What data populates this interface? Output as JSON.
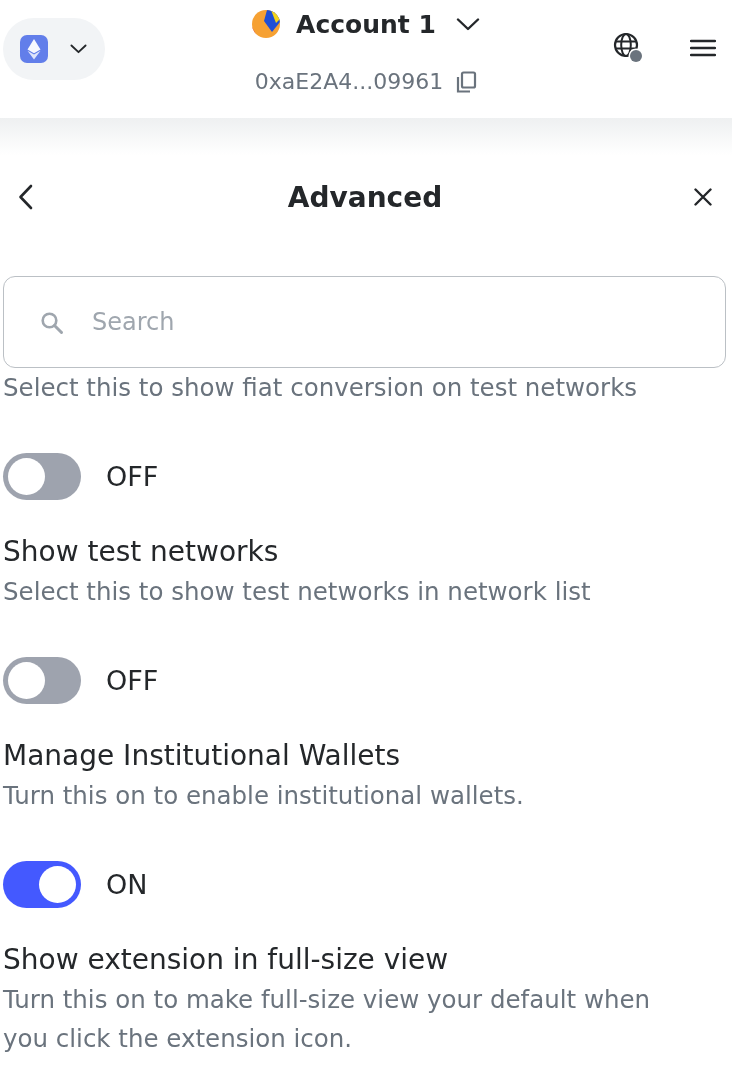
{
  "header": {
    "account_name": "Account 1",
    "address": "0xaE2A4...09961"
  },
  "page": {
    "title": "Advanced"
  },
  "search": {
    "placeholder": "Search"
  },
  "settings": [
    {
      "description": "Select this to show fiat conversion on test networks",
      "on": false,
      "toggle_label": "OFF"
    },
    {
      "title": "Show test networks",
      "description": "Select this to show test networks in network list",
      "on": false,
      "toggle_label": "OFF"
    },
    {
      "title": "Manage Institutional Wallets",
      "description": "Turn this on to enable institutional wallets.",
      "on": true,
      "toggle_label": "ON"
    },
    {
      "title": "Show extension in full-size view",
      "description": "Turn this on to make full-size view your default when you click the extension icon."
    }
  ]
}
